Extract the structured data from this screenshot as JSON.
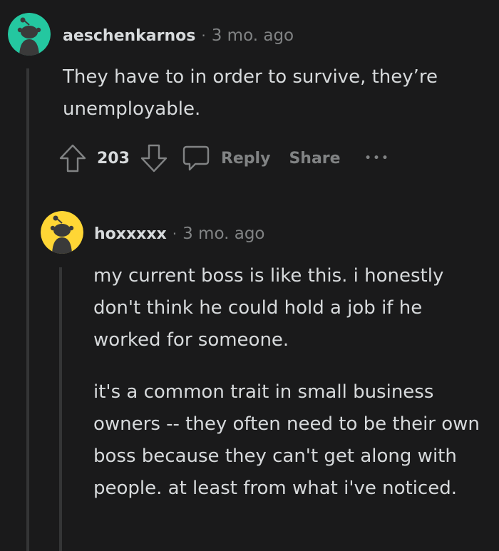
{
  "comments": [
    {
      "username": "aeschenkarnos",
      "separator": "·",
      "time": "3 mo. ago",
      "avatar_color": "#24c7a0",
      "paragraphs": [
        "They have to in order to survive, they’re unemployable."
      ],
      "votes": "203",
      "actions": {
        "reply_label": "Reply",
        "share_label": "Share",
        "more_label": "•••"
      }
    },
    {
      "username": "hoxxxxx",
      "separator": "·",
      "time": "3 mo. ago",
      "avatar_color": "#ffd635",
      "paragraphs": [
        "my current boss is like this. i honestly don't think he could hold a job if he worked for someone.",
        "it's a common trait in small business owners -- they often need to be their own boss because they can't get along with people. at least from what i've noticed."
      ]
    }
  ],
  "colors": {
    "background": "#1a1a1b",
    "text": "#d7dadc",
    "muted": "#818384",
    "thread_line": "#343536"
  }
}
